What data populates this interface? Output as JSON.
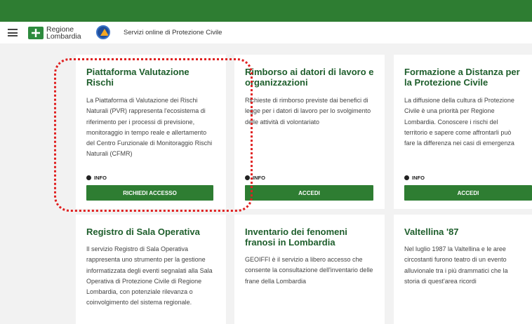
{
  "header": {
    "logo_line1": "Regione",
    "logo_line2": "Lombardia",
    "service_title": "Servizi online di Protezione Civile"
  },
  "cards": [
    {
      "title": "Piattaforma Valutazione Rischi",
      "description": "La Piattaforma di Valutazione dei Rischi Naturali (PVR) rappresenta l'ecosistema di riferimento per i processi di previsione, monitoraggio in tempo reale e allertamento del Centro Funzionale di Monitoraggio Rischi Naturali (CFMR)",
      "info_label": "INFO",
      "button_label": "RICHIEDI ACCESSO"
    },
    {
      "title": "Rimborso ai datori di lavoro e organizzazioni",
      "description": "Richieste di rimborso previste dai benefici di legge per i datori di lavoro per lo svolgimento delle attività di volontariato",
      "info_label": "INFO",
      "button_label": "ACCEDI"
    },
    {
      "title": "Formazione a Distanza per la Protezione Civile",
      "description": "La diffusione della cultura di Protezione Civile è una priorità per Regione Lombardia. Conoscere i rischi del territorio e sapere come affrontarli può fare la differenza nei casi di emergenza",
      "info_label": "INFO",
      "button_label": "ACCEDI"
    },
    {
      "title": "Registro di Sala Operativa",
      "description": "Il servizio Registro di Sala Operativa rappresenta uno strumento per la gestione informatizzata degli eventi segnalati alla Sala Operativa di Protezione Civile di Regione Lombardia, con potenziale rilevanza o coinvolgimento del sistema regionale."
    },
    {
      "title": "Inventario dei fenomeni franosi in Lombardia",
      "description": "GEOIFFI è il servizio a libero accesso che consente la consultazione dell'inventario delle frane della Lombardia"
    },
    {
      "title": "Valtellina '87",
      "description": "Nel luglio 1987 la Valtellina e le aree circostanti furono teatro di un evento alluvionale tra i più drammatici che la storia di quest'area ricordi"
    }
  ],
  "colors": {
    "brand_green": "#2e7d32",
    "title_green": "#1e5e2c",
    "highlight_red": "#e02020"
  }
}
